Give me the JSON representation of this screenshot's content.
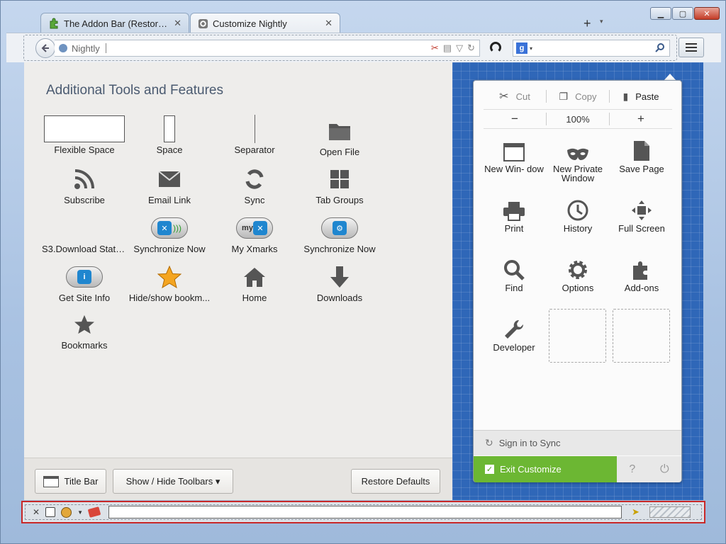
{
  "window": {
    "caption": {
      "minimize": "▁",
      "maximize": "▢",
      "close": "✕"
    }
  },
  "tabs": [
    {
      "title": "The Addon Bar (Restored...",
      "close": "✕",
      "icon": "puzzle-green-icon"
    },
    {
      "title": "Customize Nightly",
      "close": "✕",
      "icon": "gear-icon"
    }
  ],
  "tabbar": {
    "new_tab": "+",
    "list_all": "▾"
  },
  "navbar": {
    "url_text": "Nightly",
    "search_engine_badge": "g",
    "search_placeholder": ""
  },
  "palette": {
    "title": "Additional Tools and Features",
    "items": [
      {
        "label": "Flexible Space"
      },
      {
        "label": "Space"
      },
      {
        "label": "Separator"
      },
      {
        "label": "Open File"
      },
      {
        "label": "Subscribe"
      },
      {
        "label": "Email Link"
      },
      {
        "label": "Sync"
      },
      {
        "label": "Tab Groups"
      },
      {
        "label": "S3.Download Statu..."
      },
      {
        "label": "Synchronize Now"
      },
      {
        "label": "My Xmarks"
      },
      {
        "label": "Synchronize Now"
      },
      {
        "label": "Get Site Info"
      },
      {
        "label": "Hide/show bookm..."
      },
      {
        "label": "Home"
      },
      {
        "label": "Downloads"
      },
      {
        "label": "Bookmarks"
      }
    ]
  },
  "footer": {
    "title_bar": "Title Bar",
    "show_hide_toolbars": "Show / Hide Toolbars ▾",
    "restore_defaults": "Restore Defaults"
  },
  "panel": {
    "cut": "Cut",
    "copy": "Copy",
    "paste": "Paste",
    "zoom_out": "−",
    "zoom_level": "100%",
    "zoom_in": "+",
    "items": [
      {
        "label": "New Win- dow",
        "icon": "new-window-icon"
      },
      {
        "label": "New Private Window",
        "icon": "private-mask-icon"
      },
      {
        "label": "Save Page",
        "icon": "save-page-icon"
      },
      {
        "label": "Print",
        "icon": "printer-icon"
      },
      {
        "label": "History",
        "icon": "clock-icon"
      },
      {
        "label": "Full Screen",
        "icon": "fullscreen-icon"
      },
      {
        "label": "Find",
        "icon": "magnifier-icon"
      },
      {
        "label": "Options",
        "icon": "gear-icon"
      },
      {
        "label": "Add-ons",
        "icon": "puzzle-icon"
      },
      {
        "label": "Developer",
        "icon": "wrench-icon"
      }
    ],
    "sign_in": "Sign in to Sync",
    "exit_customize": "Exit Customize"
  },
  "addon_bar": {
    "close": "✕"
  },
  "colors": {
    "exit_green": "#6cb733",
    "blueprint_blue": "#2f67b8",
    "addonbar_highlight": "#c82828"
  }
}
